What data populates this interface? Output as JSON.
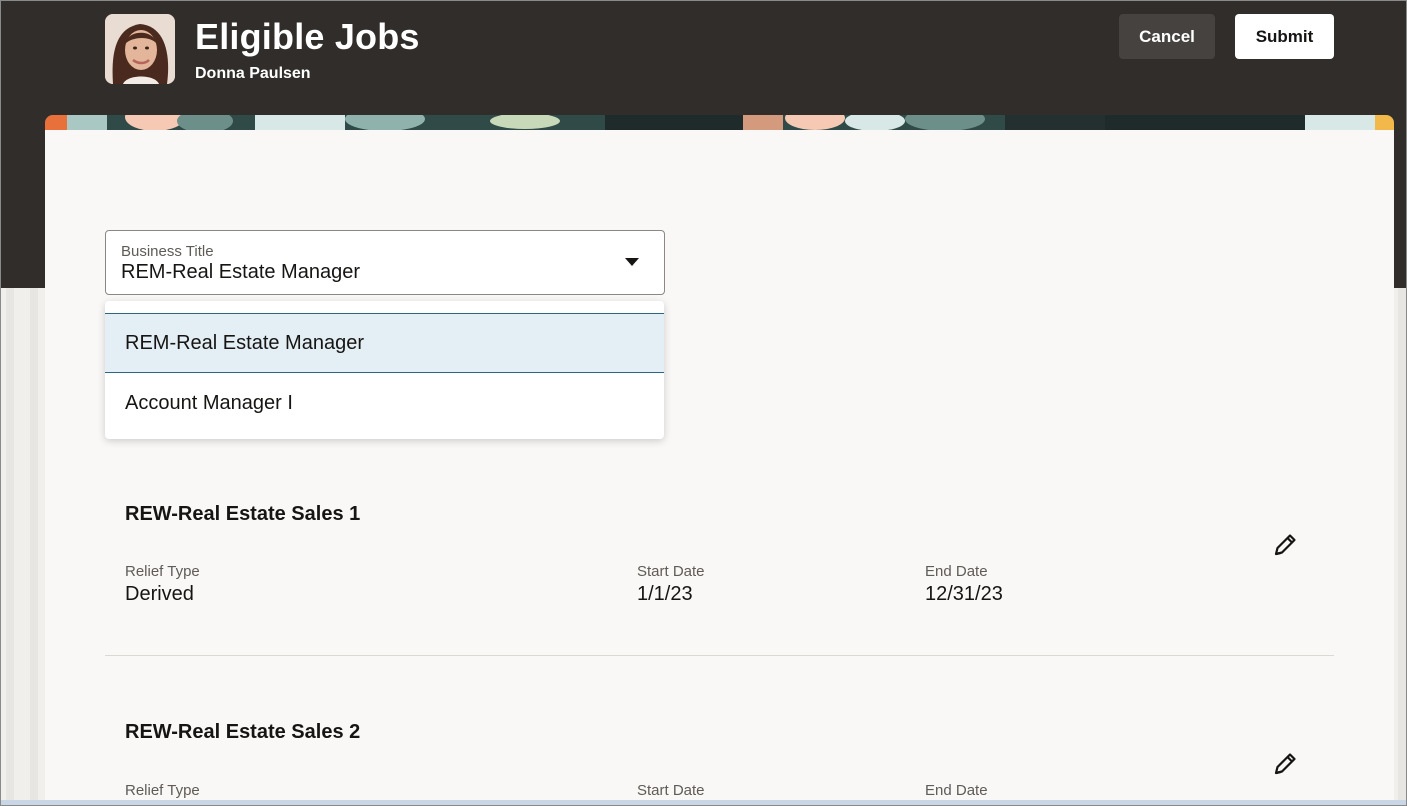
{
  "header": {
    "title": "Eligible Jobs",
    "person_name": "Donna Paulsen",
    "cancel_label": "Cancel",
    "submit_label": "Submit"
  },
  "business_title": {
    "label": "Business Title",
    "value": "REM-Real Estate Manager",
    "options": [
      "REM-Real Estate Manager",
      "Account Manager I"
    ]
  },
  "jobs": [
    {
      "title": "REW-Real Estate Sales 1",
      "relief_type_label": "Relief Type",
      "relief_type": "Derived",
      "start_date_label": "Start Date",
      "start_date": "1/1/23",
      "end_date_label": "End Date",
      "end_date": "12/31/23"
    },
    {
      "title": "REW-Real Estate Sales 2",
      "relief_type_label": "Relief Type",
      "start_date_label": "Start Date",
      "end_date_label": "End Date"
    }
  ],
  "icons": {
    "edit": "pencil-icon",
    "dropdown": "caret-down-icon"
  },
  "colors": {
    "header_bg": "#312d2a",
    "selected_option_bg": "#e4eff5",
    "selected_option_border": "#2e6580"
  }
}
